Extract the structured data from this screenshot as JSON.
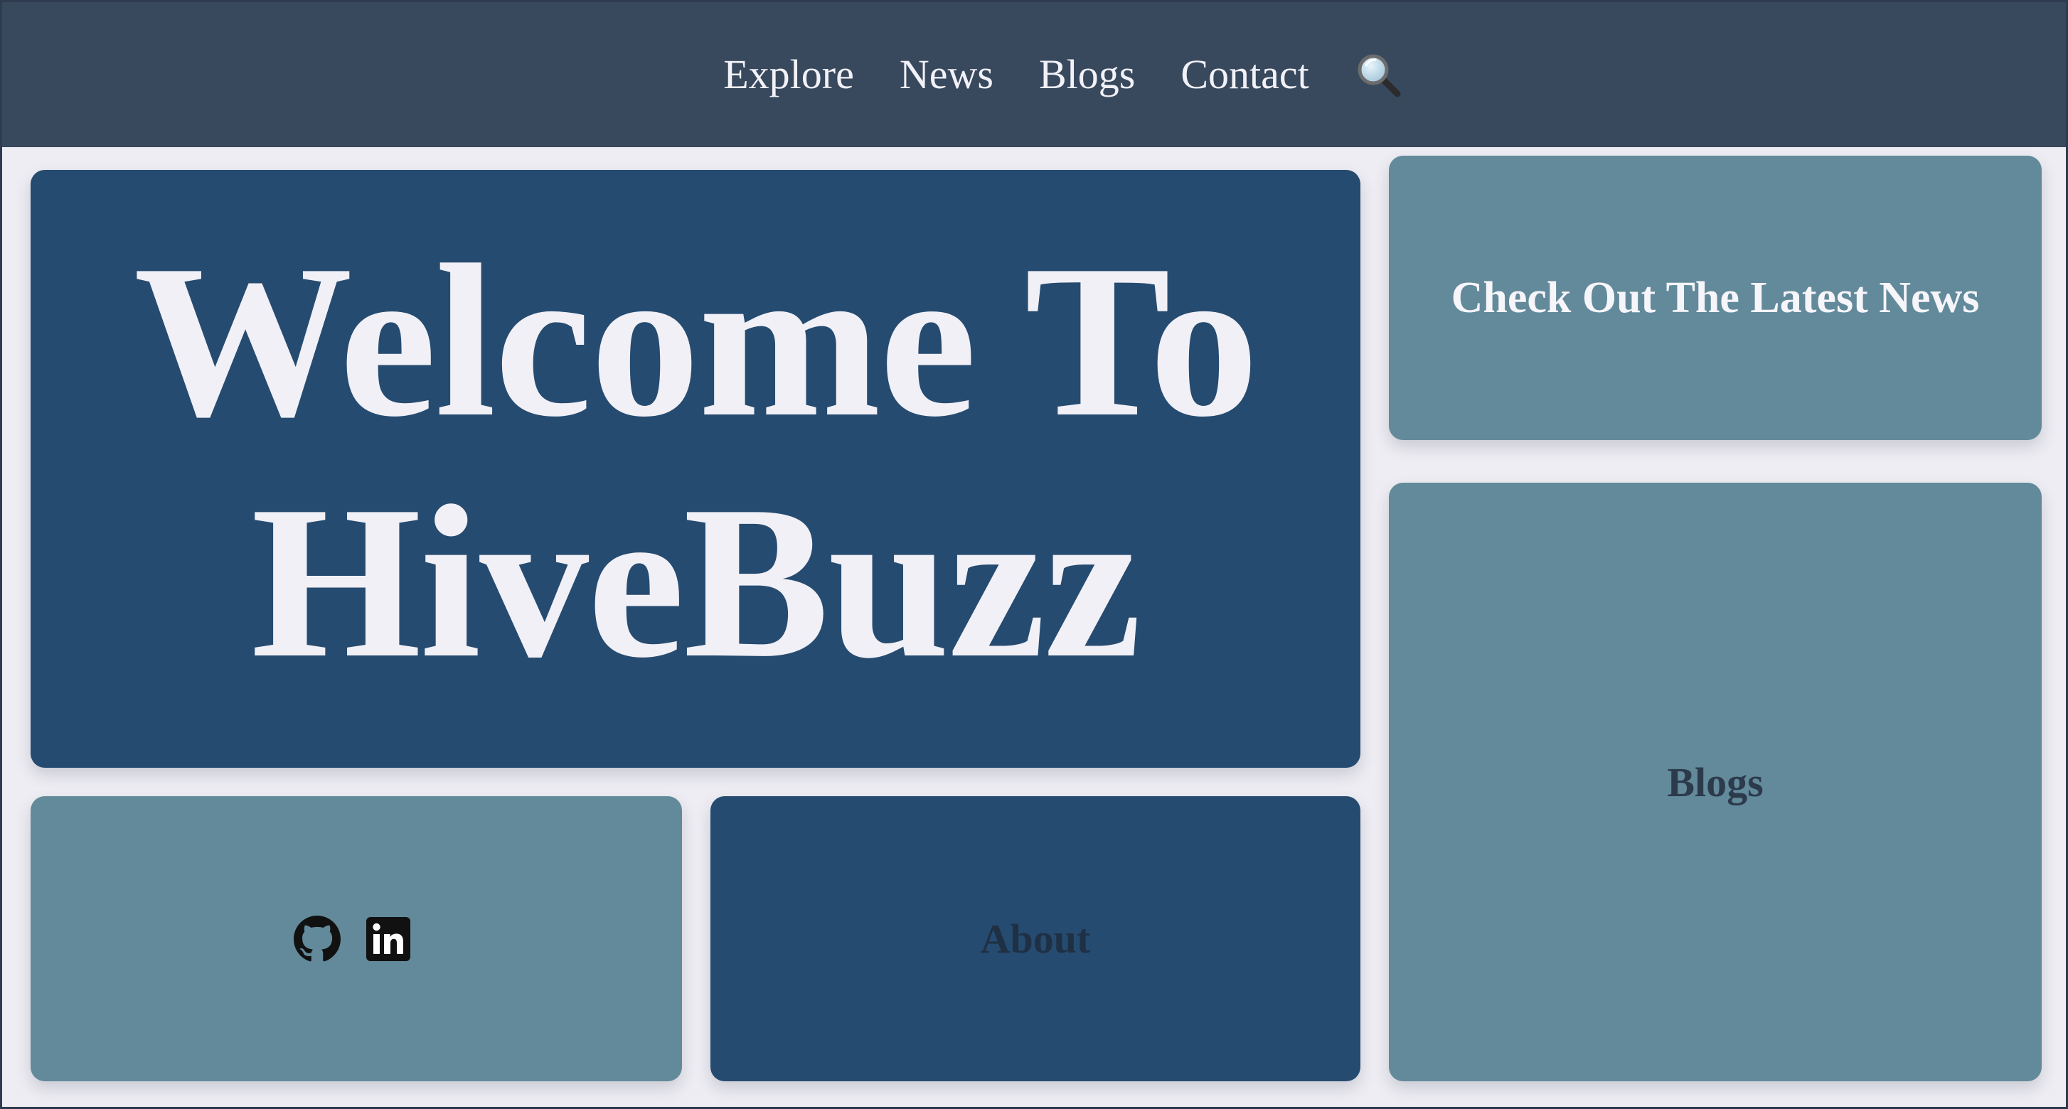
{
  "nav": {
    "links": [
      "Explore",
      "News",
      "Blogs",
      "Contact"
    ],
    "search_icon": "magnifying-glass-icon"
  },
  "hero": {
    "line1": "Welcome To",
    "line2": "HiveBuzz"
  },
  "news_tile": {
    "title": "Check Out The Latest News"
  },
  "blogs_tile": {
    "title": "Blogs"
  },
  "about_tile": {
    "title": "About"
  },
  "social": {
    "icons": [
      "github-icon",
      "linkedin-icon"
    ]
  },
  "colors": {
    "nav_bg": "#38495e",
    "page_bg": "#eeedf3",
    "tile_dark": "#264b70",
    "tile_light": "#628a9a",
    "text_light": "#f1f0f6",
    "text_dark": "#2c3a4c"
  }
}
